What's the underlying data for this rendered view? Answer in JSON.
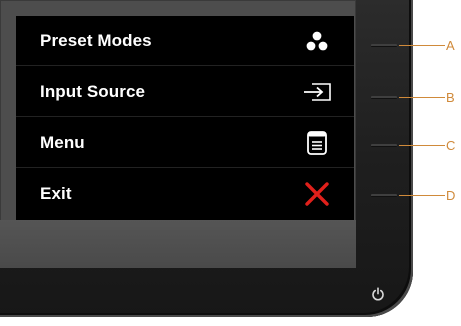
{
  "osd_menu": {
    "items": [
      {
        "label": "Preset Modes",
        "icon": "preset-modes-icon"
      },
      {
        "label": "Input Source",
        "icon": "input-source-icon"
      },
      {
        "label": "Menu",
        "icon": "menu-icon"
      },
      {
        "label": "Exit",
        "icon": "exit-icon"
      }
    ]
  },
  "callouts": {
    "labels": [
      "A",
      "B",
      "C",
      "D"
    ]
  },
  "colors": {
    "osd_background": "#000000",
    "label_text": "#ffffff",
    "exit_icon": "#e0201b",
    "callout": "#d08a3a",
    "bezel": "#222222",
    "screen": "#4d4d4d"
  },
  "icons": {
    "power_button": "power-icon"
  }
}
